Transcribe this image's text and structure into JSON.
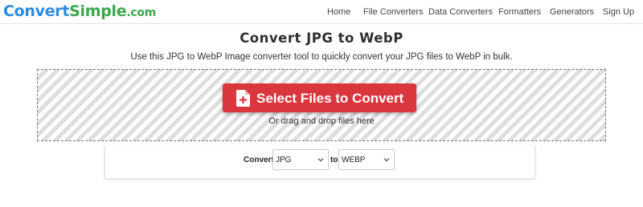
{
  "brand": {
    "part1": "Convert",
    "part2": "Simple",
    "part3": ".com"
  },
  "nav": {
    "items": [
      {
        "label": "Home"
      },
      {
        "label": "File Converters"
      },
      {
        "label": "Data Converters"
      },
      {
        "label": "Formatters"
      },
      {
        "label": "Generators"
      },
      {
        "label": "Sign Up"
      }
    ]
  },
  "main": {
    "title": "Convert JPG to WebP",
    "subtitle": "Use this JPG to WebP Image converter tool to quickly convert your JPG files to WebP in bulk.",
    "select_button": "Select Files to Convert",
    "drag_text": "Or drag and drop files here",
    "button_color": "#d9363e"
  },
  "converter": {
    "convert_label": "Convert",
    "from_value": "JPG",
    "to_label": "to",
    "to_value": "WEBP"
  },
  "icons": {
    "file": "file-plus-icon",
    "dropdown": "chevron-down-icon"
  }
}
